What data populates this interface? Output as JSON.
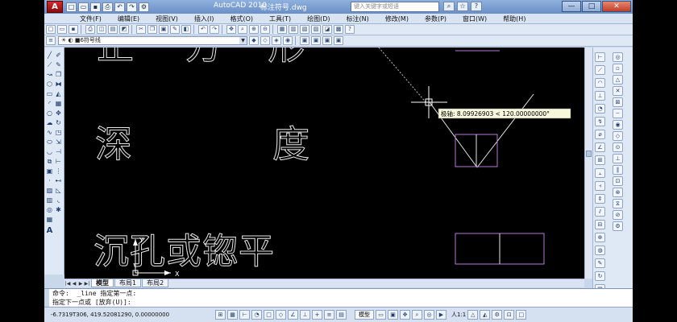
{
  "window": {
    "app_logo": "A",
    "app_title": "AutoCAD 2010",
    "file_name": "标注符号.dwg",
    "search_placeholder": "键入关键字或短语",
    "controls": [
      "—",
      "□",
      "✕"
    ]
  },
  "menu": {
    "items": [
      "文件(F)",
      "编辑(E)",
      "视图(V)",
      "插入(I)",
      "格式(O)",
      "工具(T)",
      "绘图(D)",
      "标注(N)",
      "修改(M)",
      "参数(P)",
      "窗口(W)",
      "帮助(H)"
    ]
  },
  "toolbar": {
    "layer_value": "6符号线"
  },
  "canvas": {
    "texts": {
      "top_row_1": "正",
      "top_row_2": "方",
      "top_row_3": "形",
      "depth_1": "深",
      "depth_2": "度",
      "counterbore": "沉孔或锪平"
    },
    "tooltip": "极轴: 8.09926903 < 120.00000000°",
    "ucs": {
      "x": "X",
      "y": "Y"
    }
  },
  "layout_tabs": {
    "tabs": [
      "模型",
      "布局1",
      "布局2"
    ],
    "active": "模型"
  },
  "command": {
    "line1": "命令:  _line 指定第一点:",
    "line2": "指定下一点或 [放弃(U)]:"
  },
  "status": {
    "coords": "-6.7319T306,  419.52081290, 0.00000000",
    "model_label": "模型",
    "scale_label": "人1:1"
  },
  "colors": {
    "canvas_bg": "#000000",
    "line": "#e6e6e6",
    "magenta": "#b57ad6",
    "cyan": "#3ad0d0"
  }
}
